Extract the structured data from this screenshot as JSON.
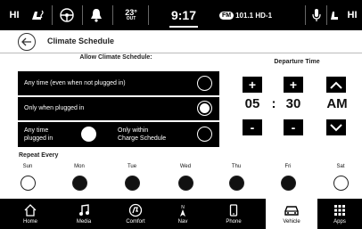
{
  "status_bar": {
    "profile_label": "HI",
    "outside_temp": "23°",
    "outside_label": "OUT",
    "clock": "9:17",
    "radio_badge": "FM",
    "radio_station": "101.1 HD-1",
    "right_label": "HI"
  },
  "title_bar": {
    "title": "Climate Schedule"
  },
  "allow_section": {
    "header": "Allow Climate Schedule:",
    "options": [
      {
        "label": "Any time (even when not plugged in)",
        "selected": false
      },
      {
        "label": "Only when plugged in",
        "selected": true
      }
    ],
    "split_option": {
      "left_label_line1": "Any time",
      "left_label_line2": "plugged in",
      "right_label_line1": "Only within",
      "right_label_line2": "Charge Schedule"
    }
  },
  "departure": {
    "header": "Departure Time",
    "hours": "05",
    "separator": ":",
    "minutes": "30",
    "period": "AM",
    "plus_symbol": "+",
    "minus_symbol": "-"
  },
  "repeat": {
    "label": "Repeat Every",
    "days": [
      {
        "name": "Sun",
        "on": false
      },
      {
        "name": "Mon",
        "on": true
      },
      {
        "name": "Tue",
        "on": true
      },
      {
        "name": "Wed",
        "on": true
      },
      {
        "name": "Thu",
        "on": true
      },
      {
        "name": "Fri",
        "on": true
      },
      {
        "name": "Sat",
        "on": false
      }
    ]
  },
  "bottom_nav": {
    "items": [
      {
        "label": "Home",
        "icon": "home-icon"
      },
      {
        "label": "Media",
        "icon": "music-note-icon"
      },
      {
        "label": "Comfort",
        "icon": "comfort-icon"
      },
      {
        "label": "Nav",
        "icon": "compass-icon"
      },
      {
        "label": "Phone",
        "icon": "phone-icon"
      },
      {
        "label": "Vehicle",
        "icon": "vehicle-icon",
        "active": true
      },
      {
        "label": "Apps",
        "icon": "apps-grid-icon"
      }
    ]
  }
}
